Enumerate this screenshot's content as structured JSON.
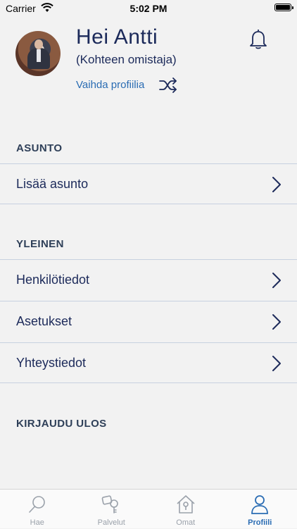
{
  "status_bar": {
    "carrier": "Carrier",
    "time": "5:02 PM"
  },
  "profile": {
    "greeting": "Hei Antti",
    "role": "(Kohteen omistaja)",
    "switch_profile": "Vaihda profiilia"
  },
  "sections": {
    "home": {
      "title": "ASUNTO",
      "items": [
        {
          "label": "Lisää asunto"
        }
      ]
    },
    "general": {
      "title": "YLEINEN",
      "items": [
        {
          "label": "Henkilötiedot"
        },
        {
          "label": "Asetukset"
        },
        {
          "label": "Yhteystiedot"
        }
      ]
    },
    "logout": {
      "title": "KIRJAUDU ULOS"
    }
  },
  "tabs": [
    {
      "label": "Hae",
      "icon": "search-icon"
    },
    {
      "label": "Palvelut",
      "icon": "keys-icon"
    },
    {
      "label": "Omat",
      "icon": "house-icon"
    },
    {
      "label": "Profiili",
      "icon": "person-icon",
      "active": true
    }
  ],
  "colors": {
    "accent": "#2a6cb3",
    "text_dark": "#1c2a5a",
    "section_header": "#2e3f58",
    "background": "#f2f2f2",
    "tab_inactive": "#9aa1aa"
  }
}
